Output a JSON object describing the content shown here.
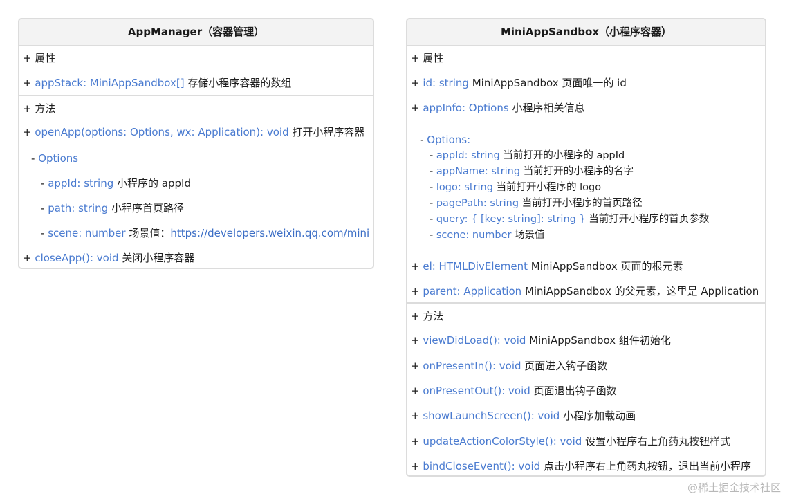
{
  "left": {
    "title": "AppManager（容器管理）",
    "props_header": "属性",
    "props": [
      {
        "code": "appStack: MiniAppSandbox[]",
        "desc": "存储小程序容器的数组"
      }
    ],
    "methods_header": "方法",
    "open_app": {
      "code": "openApp(options: Options, wx: Application): void",
      "desc": "打开小程序容器"
    },
    "options_label": "Options",
    "options": [
      {
        "code": "appId: string",
        "desc": "小程序的 appId"
      },
      {
        "code": "path: string",
        "desc": "小程序首页路径"
      },
      {
        "code": "scene: number",
        "desc": "场景值：",
        "link": "https://developers.weixin.qq.com/mini"
      }
    ],
    "close_app": {
      "code": "closeApp(): void",
      "desc": "关闭小程序容器"
    }
  },
  "right": {
    "title": "MiniAppSandbox（小程序容器）",
    "props_header": "属性",
    "id_prop": {
      "code": "id: string",
      "desc": "MiniAppSandbox 页面唯一的 id"
    },
    "appinfo_prop": {
      "code": "appInfo: Options",
      "desc": "小程序相关信息"
    },
    "options_label": "Options:",
    "options": [
      {
        "code": "appId: string",
        "desc": "当前打开的小程序的 appId"
      },
      {
        "code": "appName: string",
        "desc": "当前打开的小程序的名字"
      },
      {
        "code": "logo: string",
        "desc": "当前打开小程序的 logo"
      },
      {
        "code": "pagePath: string",
        "desc": "当前打开小程序的首页路径"
      },
      {
        "code": "query: { [key: string]: string }",
        "desc": "当前打开小程序的首页参数"
      },
      {
        "code": "scene: number",
        "desc": "场景值"
      }
    ],
    "el_prop": {
      "code": "el: HTMLDivElement",
      "desc": "MiniAppSandbox 页面的根元素"
    },
    "parent_prop": {
      "code": "parent: Application",
      "desc": "MiniAppSandbox 的父元素，这里是 Application"
    },
    "methods_header": "方法",
    "methods": [
      {
        "code": "viewDidLoad(): void",
        "desc": "MiniAppSandbox 组件初始化"
      },
      {
        "code": "onPresentIn(): void",
        "desc": "页面进入钩子函数"
      },
      {
        "code": "onPresentOut(): void",
        "desc": "页面退出钩子函数"
      },
      {
        "code": "showLaunchScreen(): void",
        "desc": "小程序加载动画"
      },
      {
        "code": "updateActionColorStyle(): void",
        "desc": "设置小程序右上角药丸按钮样式"
      },
      {
        "code": "bindCloseEvent(): void",
        "desc": "点击小程序右上角药丸按钮，退出当前小程序"
      }
    ]
  },
  "watermark": "@稀土掘金技术社区",
  "colors": {
    "code": "#4a7bd0",
    "border": "#dcdcdc",
    "title_bg": "#f3f3f3"
  }
}
